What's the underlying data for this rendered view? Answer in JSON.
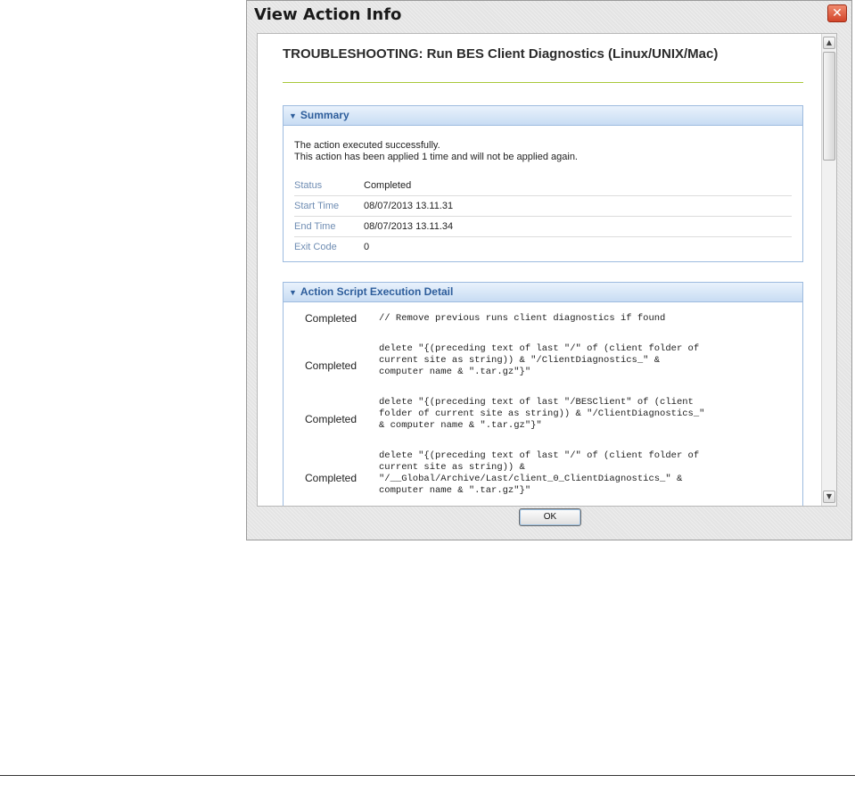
{
  "window": {
    "title": "View Action Info",
    "close_label": "✕"
  },
  "page": {
    "title": "TROUBLESHOOTING: Run BES Client Diagnostics (Linux/UNIX/Mac)"
  },
  "summary": {
    "header": "Summary",
    "message_line1": "The action executed successfully.",
    "message_line2": "This action has been applied 1 time and will not be applied again.",
    "rows": [
      {
        "label": "Status",
        "value": "Completed"
      },
      {
        "label": "Start Time",
        "value": "08/07/2013 13.11.31"
      },
      {
        "label": "End Time",
        "value": "08/07/2013 13.11.34"
      },
      {
        "label": "Exit Code",
        "value": "0"
      }
    ]
  },
  "detail": {
    "header": "Action Script Execution Detail",
    "rows": [
      {
        "status": "Completed",
        "script": "// Remove previous runs client diagnostics if found"
      },
      {
        "status": "Completed",
        "script": "delete \"{(preceding text of last \"/\" of (client folder of\ncurrent site as string)) & \"/ClientDiagnostics_\" &\ncomputer name & \".tar.gz\"}\""
      },
      {
        "status": "Completed",
        "script": "delete \"{(preceding text of last \"/BESClient\" of (client\nfolder of current site as string)) & \"/ClientDiagnostics_\"\n& computer name & \".tar.gz\"}\""
      },
      {
        "status": "Completed",
        "script": "delete \"{(preceding text of last \"/\" of (client folder of\ncurrent site as string)) &\n\"/__Global/Archive/Last/client_0_ClientDiagnostics_\" &\ncomputer name & \".tar.gz\"}\""
      }
    ]
  },
  "buttons": {
    "ok": "OK"
  },
  "icons": {
    "collapse_arrow": "▼",
    "scroll_up": "▲",
    "scroll_down": "▼"
  },
  "colors": {
    "accent_rule": "#a8c83a",
    "panel_header_text": "#2d5d9b",
    "close_button": "#d2452a"
  }
}
